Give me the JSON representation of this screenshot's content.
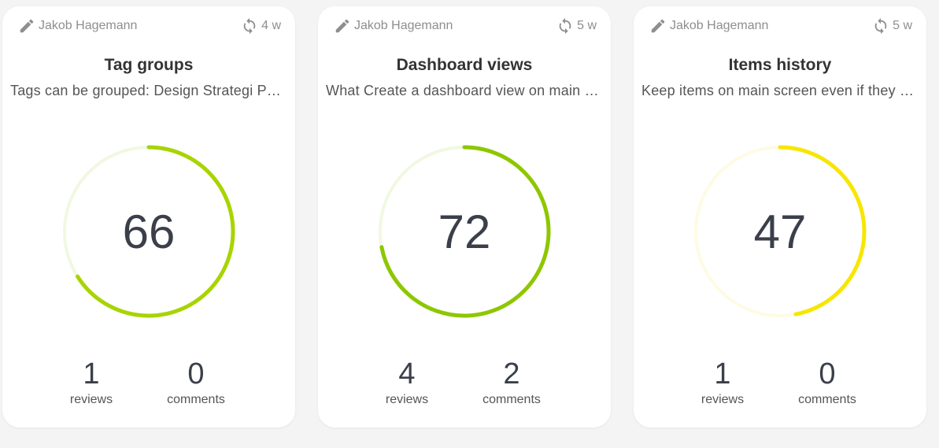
{
  "cards": [
    {
      "author": "Jakob Hagemann",
      "age": "4 w",
      "title": "Tag groups",
      "description": "Tags can be grouped: Design Strategi Product",
      "score": "66",
      "score_value": 66,
      "color": "#a8d400",
      "track_color": "#f1f8e2",
      "reviews_count": "1",
      "reviews_label": "reviews",
      "comments_count": "0",
      "comments_label": "comments"
    },
    {
      "author": "Jakob Hagemann",
      "age": "5 w",
      "title": "Dashboard views",
      "description": "What Create a dashboard view on main screen",
      "score": "72",
      "score_value": 72,
      "color": "#8dc700",
      "track_color": "#f1f8e2",
      "reviews_count": "4",
      "reviews_label": "reviews",
      "comments_count": "2",
      "comments_label": "comments"
    },
    {
      "author": "Jakob Hagemann",
      "age": "5 w",
      "title": "Items history",
      "description": "Keep items on main screen even if they are old",
      "score": "47",
      "score_value": 47,
      "color": "#f7e600",
      "track_color": "#fefbe3",
      "reviews_count": "1",
      "reviews_label": "reviews",
      "comments_count": "0",
      "comments_label": "comments"
    }
  ]
}
